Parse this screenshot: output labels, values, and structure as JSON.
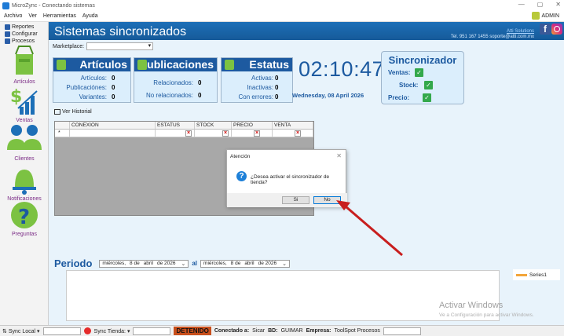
{
  "window": {
    "title": "MicroZync - Conectando sistemas"
  },
  "menu": [
    "Archivo",
    "Ver",
    "Herramientas",
    "Ayuda"
  ],
  "user": "ADMIN",
  "sidebar": {
    "top_items": [
      "Reportes",
      "Configurar",
      "Procesos"
    ],
    "items": [
      "Artículos",
      "Ventas",
      "Clientes",
      "Notificaciones",
      "Preguntas"
    ]
  },
  "header": {
    "title": "Sistemas sincronizados",
    "company": "Atti Solutions",
    "contact": "Tel. 951 167 1455  soporte@atti.com.mx"
  },
  "marketplace": {
    "label": "Marketplace:",
    "value": ""
  },
  "articulos": {
    "title": "Artículos",
    "rows": [
      {
        "label": "Artículos:",
        "value": "0"
      },
      {
        "label": "Publicaciónes:",
        "value": "0"
      },
      {
        "label": "Variantes:",
        "value": "0"
      }
    ]
  },
  "publicaciones": {
    "title": "Publicaciones",
    "rows": [
      {
        "label": "Relacionados:",
        "value": "0"
      },
      {
        "label": "No relacionados:",
        "value": "0"
      }
    ]
  },
  "estatus": {
    "title": "Estatus",
    "rows": [
      {
        "label": "Activas:",
        "value": "0"
      },
      {
        "label": "Inactivas:",
        "value": "0"
      },
      {
        "label": "Con errores:",
        "value": "0"
      }
    ]
  },
  "clock": {
    "time": "02:10:47",
    "date": "Wednesday, 08 April 2026"
  },
  "sincronizador": {
    "title": "Sincronizador",
    "items": [
      {
        "label": "Ventas:",
        "checked": true
      },
      {
        "label": "Stock:",
        "checked": true
      },
      {
        "label": "Precio:",
        "checked": true
      }
    ]
  },
  "history": {
    "label": "Ver Historial"
  },
  "grid": {
    "columns": [
      "",
      "CONEXION",
      "ESTATUS",
      "STOCK",
      "PRECIO",
      "VENTA"
    ],
    "new_row_marker": "*"
  },
  "periodo": {
    "label": "Periodo",
    "from": {
      "weekday": "miércoles,",
      "day": "8 de",
      "month": "abril",
      "year": "de 2026"
    },
    "sep": "al",
    "to": {
      "weekday": "miércoles,",
      "day": "8 de",
      "month": "abril",
      "year": "de 2026"
    }
  },
  "chart": {
    "legend": "Series1"
  },
  "watermark": {
    "line1": "Activar Windows",
    "line2": "Ve a Configuración para activar Windows."
  },
  "dialog": {
    "title": "Atención",
    "message": "¿Desea activar el sincronizador de tienda?",
    "yes": "Si",
    "no": "No"
  },
  "statusbar": {
    "sync_local": "Sync Local",
    "sync_tienda": "Sync Tienda:",
    "state": "DETENIDO",
    "connected_label": "Conectado a:",
    "connected_value": "Sicar",
    "bd_label": "BD:",
    "bd_value": "GUIMAR",
    "empresa_label": "Empresa:",
    "empresa_value": "ToolSpot Procesos"
  },
  "colors": {
    "accent": "#1d5aa0",
    "header": "#1d6fb7",
    "stop": "#c84f1c",
    "check": "#33a84b",
    "arrow": "#c81e1e"
  }
}
